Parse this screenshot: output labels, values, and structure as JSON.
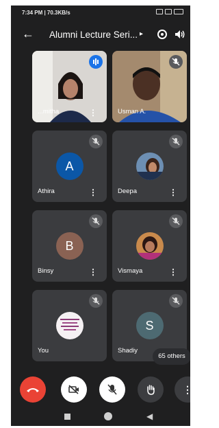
{
  "status_bar": {
    "time_info": "7:34 PM | 70.3KB/s"
  },
  "header": {
    "title": "Alumni Lecture Seri..."
  },
  "participants": [
    {
      "name": "...mitha",
      "mode": "video"
    },
    {
      "name": "Usman A.",
      "mode": "video"
    },
    {
      "name": "Athira",
      "mode": "initial",
      "initial": "A",
      "color": "#0b57a7"
    },
    {
      "name": "Deepa",
      "mode": "photo"
    },
    {
      "name": "Binsy",
      "mode": "initial",
      "initial": "B",
      "color": "#8a6253"
    },
    {
      "name": "Vismaya",
      "mode": "photo"
    },
    {
      "name": "You",
      "mode": "photo"
    },
    {
      "name": "Shadiy",
      "mode": "initial",
      "initial": "S",
      "color": "#4d6a72"
    }
  ],
  "others_badge": "65 others",
  "controls": {
    "end_call": "end-call",
    "camera": "camera-off",
    "mic": "mic-off",
    "hand": "raise-hand",
    "more": "more-options"
  },
  "colors": {
    "background": "#1f1f20",
    "tile": "#3b3c3f",
    "end_call": "#ea4335",
    "speaking": "#1a73e8"
  }
}
